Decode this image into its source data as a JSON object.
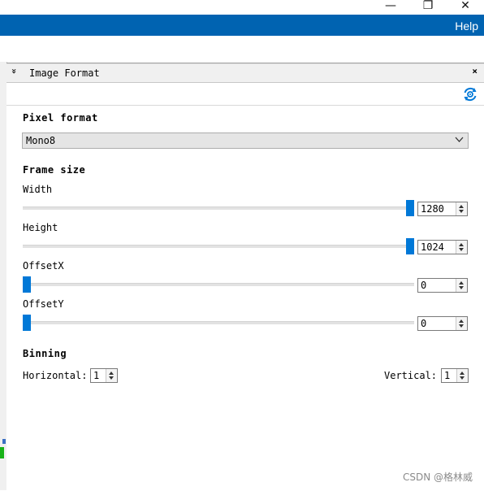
{
  "window": {
    "minimize_glyph": "—",
    "maximize_glyph": "❐",
    "close_glyph": "✕"
  },
  "menu": {
    "help_label": "Help"
  },
  "panel": {
    "collapse_glyph": "»",
    "title": "Image Format",
    "close_glyph": "×"
  },
  "pixel_format": {
    "section_title": "Pixel format",
    "selected": "Mono8"
  },
  "frame_size": {
    "section_title": "Frame size",
    "width": {
      "label": "Width",
      "value": "1280",
      "level": 1.0
    },
    "height": {
      "label": "Height",
      "value": "1024",
      "level": 1.0
    },
    "offset_x": {
      "label": "OffsetX",
      "value": "0",
      "level": 0.0
    },
    "offset_y": {
      "label": "OffsetY",
      "value": "0",
      "level": 0.0
    }
  },
  "binning": {
    "section_title": "Binning",
    "horizontal_label": "Horizontal:",
    "horizontal_value": "1",
    "vertical_label": "Vertical:",
    "vertical_value": "1"
  },
  "watermark": "CSDN @格林威",
  "colors": {
    "accent": "#0063b1",
    "slider_thumb": "#0078d7",
    "status_green": "#18b218"
  }
}
